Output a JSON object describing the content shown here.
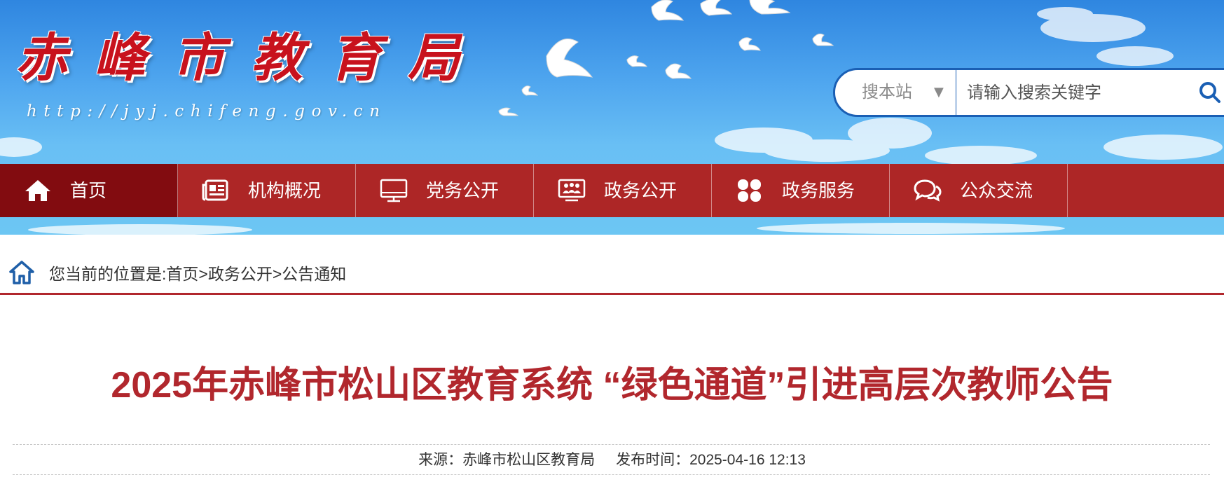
{
  "header": {
    "site_title": "赤峰市教育局",
    "site_url": "http://jyj.chifeng.gov.cn",
    "search": {
      "scope_label": "搜本站",
      "scope_caret": "▼",
      "placeholder": "请输入搜索关键字",
      "button_icon": "search-icon"
    }
  },
  "nav": {
    "items": [
      {
        "label": "首页",
        "icon": "home-icon",
        "active": true
      },
      {
        "label": "机构概况",
        "icon": "newspaper-icon",
        "active": false
      },
      {
        "label": "党务公开",
        "icon": "monitor-icon",
        "active": false
      },
      {
        "label": "政务公开",
        "icon": "group-screen-icon",
        "active": false
      },
      {
        "label": "政务服务",
        "icon": "grid-icon",
        "active": false
      },
      {
        "label": "公众交流",
        "icon": "chat-bubbles-icon",
        "active": false
      }
    ]
  },
  "breadcrumb": {
    "prefix": "您当前的位置是:",
    "items": [
      "首页",
      "政务公开",
      "公告通知"
    ],
    "separator": ">"
  },
  "article": {
    "title": "2025年赤峰市松山区教育系统 “绿色通道”引进高层次教师公告",
    "source_label": "来源：",
    "source": "赤峰市松山区教育局",
    "time_label": "发布时间：",
    "time": "2025-04-16 12:13"
  },
  "colors": {
    "nav_bg": "#ad2626",
    "nav_active": "#820c10",
    "title_red": "#b1272d",
    "search_border": "#1a5fb4"
  }
}
